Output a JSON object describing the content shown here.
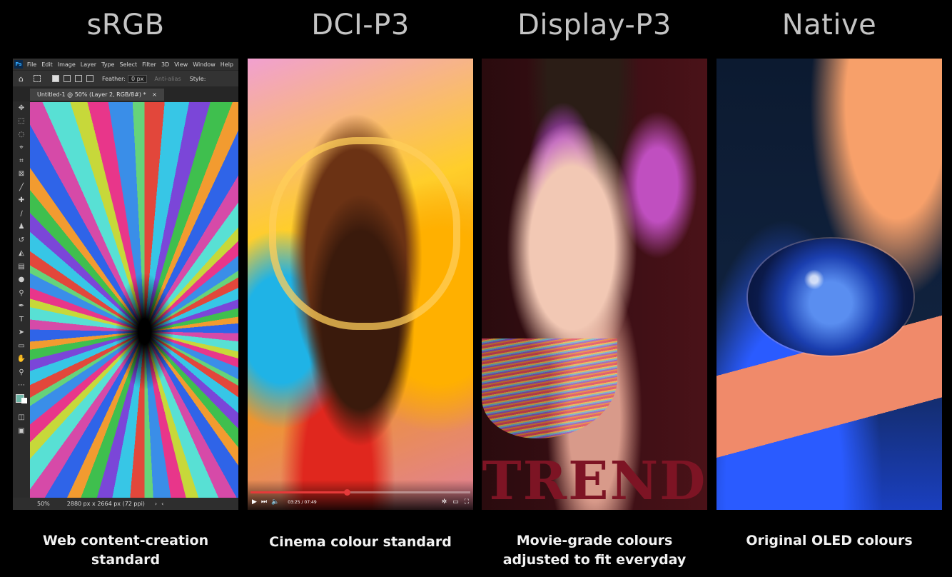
{
  "panels": [
    {
      "heading": "sRGB",
      "caption_lines": [
        "Web content-creation",
        "standard"
      ]
    },
    {
      "heading": "DCI-P3",
      "caption_lines": [
        "Cinema colour standard"
      ]
    },
    {
      "heading": "Display-P3",
      "caption_lines": [
        "Movie-grade colours",
        "adjusted to fit everyday"
      ]
    },
    {
      "heading": "Native",
      "caption_lines": [
        "Original OLED colours"
      ]
    }
  ],
  "editor": {
    "app_badge": "Ps",
    "menu": [
      "File",
      "Edit",
      "Image",
      "Layer",
      "Type",
      "Select",
      "Filter",
      "3D",
      "View",
      "Window",
      "Help"
    ],
    "options": {
      "feather_label": "Feather:",
      "feather_value": "0 px",
      "anti_alias": "Anti-alias",
      "style_label": "Style:"
    },
    "doc_tab": "Untitled-1 @ 50% (Layer 2, RGB/8#) *",
    "tools": [
      "move-icon",
      "marquee-icon",
      "lasso-icon",
      "quick-select-icon",
      "crop-icon",
      "frame-icon",
      "eyedropper-icon",
      "healing-icon",
      "brush-icon",
      "stamp-icon",
      "history-brush-icon",
      "eraser-icon",
      "gradient-icon",
      "blur-icon",
      "dodge-icon",
      "pen-icon",
      "type-icon",
      "path-select-icon",
      "rectangle-icon",
      "hand-icon",
      "zoom-icon"
    ],
    "status": {
      "zoom": "50%",
      "doc_info": "2880 px x 2664 px (72 ppi)"
    }
  },
  "video": {
    "time": "03:25 / 07:49",
    "progress": 0.437
  },
  "magazine": {
    "masthead": "TREND"
  }
}
